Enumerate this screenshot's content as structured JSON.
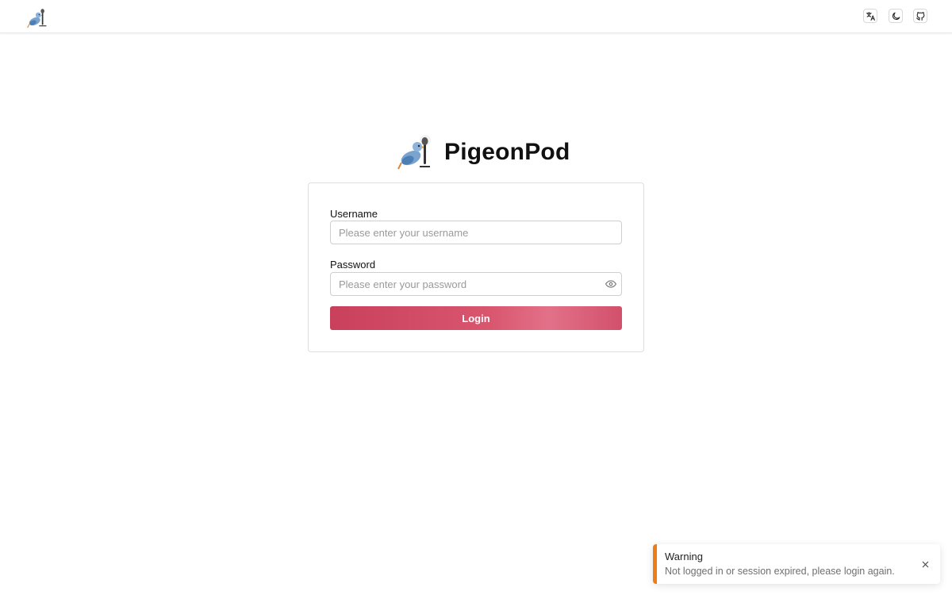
{
  "app": {
    "name": "PigeonPod",
    "logo_icon": "pigeon-microphone-logo"
  },
  "topbar": {
    "actions": [
      {
        "icon": "translate-icon"
      },
      {
        "icon": "moon-icon"
      },
      {
        "icon": "github-icon"
      }
    ]
  },
  "login": {
    "username_label": "Username",
    "username_placeholder": "Please enter your username",
    "username_value": "",
    "password_label": "Password",
    "password_placeholder": "Please enter your password",
    "password_value": "",
    "password_toggle_icon": "eye-icon",
    "submit_label": "Login"
  },
  "toast": {
    "title": "Warning",
    "message": "Not logged in or session expired, please login again.",
    "accent_color": "#f07c16",
    "close_icon": "close-icon"
  },
  "colors": {
    "primary": "#d24f6a",
    "warning": "#f07c16"
  }
}
